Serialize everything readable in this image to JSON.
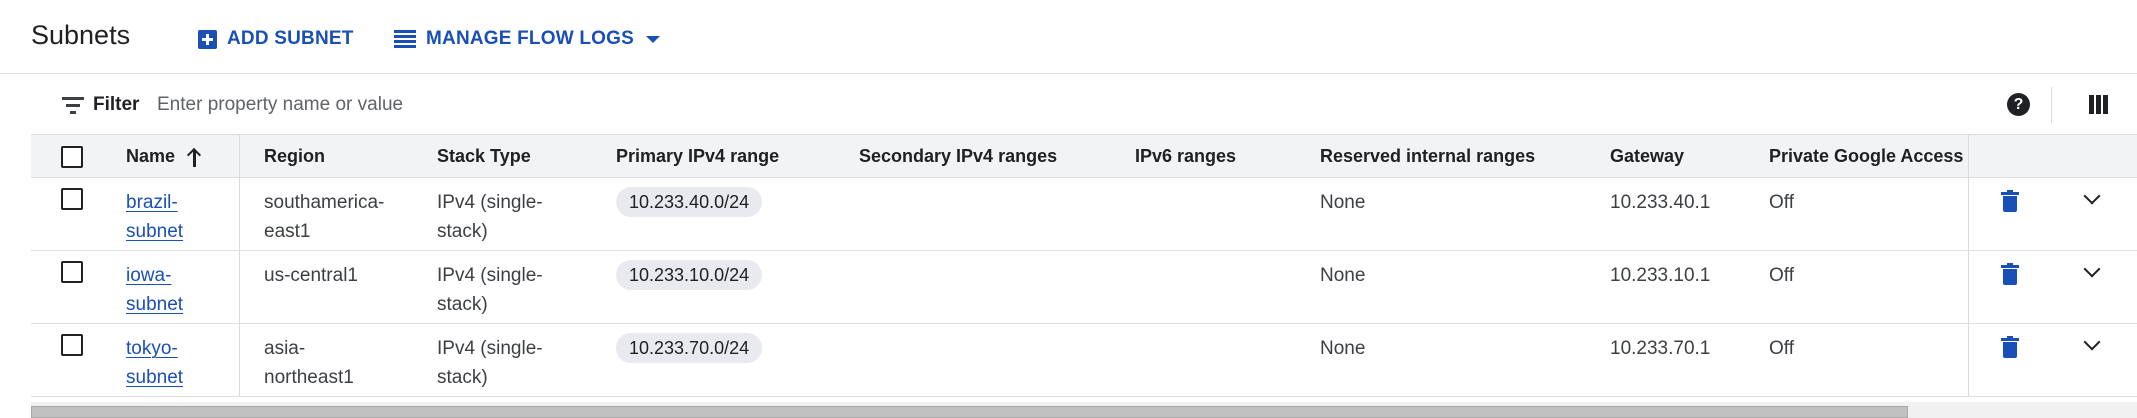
{
  "header": {
    "title": "Subnets",
    "add_subnet_label": "ADD SUBNET",
    "manage_flow_logs_label": "MANAGE FLOW LOGS"
  },
  "filter": {
    "label": "Filter",
    "placeholder": "Enter property name or value",
    "help_glyph": "?"
  },
  "table": {
    "columns": {
      "name": "Name",
      "region": "Region",
      "stack_type": "Stack Type",
      "primary_ipv4": "Primary IPv4 range",
      "secondary_ipv4": "Secondary IPv4 ranges",
      "ipv6": "IPv6 ranges",
      "reserved_internal": "Reserved internal ranges",
      "gateway": "Gateway",
      "private_google_access": "Private Google Access"
    },
    "sort": {
      "column": "name",
      "direction": "ascending"
    },
    "rows": [
      {
        "name_line1": "brazil-",
        "name_line2": "subnet",
        "region_line1": "southamerica-",
        "region_line2": "east1",
        "stack_line1": "IPv4 (single-",
        "stack_line2": "stack)",
        "primary_ipv4": "10.233.40.0/24",
        "secondary_ipv4": "",
        "ipv6": "",
        "reserved_internal": "None",
        "gateway": "10.233.40.1",
        "private_google_access": "Off"
      },
      {
        "name_line1": "iowa-",
        "name_line2": "subnet",
        "region_line1": "us-central1",
        "region_line2": "",
        "stack_line1": "IPv4 (single-",
        "stack_line2": "stack)",
        "primary_ipv4": "10.233.10.0/24",
        "secondary_ipv4": "",
        "ipv6": "",
        "reserved_internal": "None",
        "gateway": "10.233.10.1",
        "private_google_access": "Off"
      },
      {
        "name_line1": "tokyo-",
        "name_line2": "subnet",
        "region_line1": "asia-",
        "region_line2": "northeast1",
        "stack_line1": "IPv4 (single-",
        "stack_line2": "stack)",
        "primary_ipv4": "10.233.70.0/24",
        "secondary_ipv4": "",
        "ipv6": "",
        "reserved_internal": "None",
        "gateway": "10.233.70.1",
        "private_google_access": "Off"
      }
    ]
  },
  "colors": {
    "accent": "#1a4fb8",
    "header_bg": "#f1f3f4",
    "chip_bg": "#e8eaed",
    "text": "#202124"
  },
  "icons": {
    "add": "add-box-icon",
    "flow_logs": "list-icon",
    "dropdown": "caret-down-icon",
    "filter": "filter-icon",
    "help": "help-icon",
    "columns": "column-display-icon",
    "sort": "arrow-up-icon",
    "delete": "trash-icon",
    "expand": "chevron-down-icon"
  }
}
